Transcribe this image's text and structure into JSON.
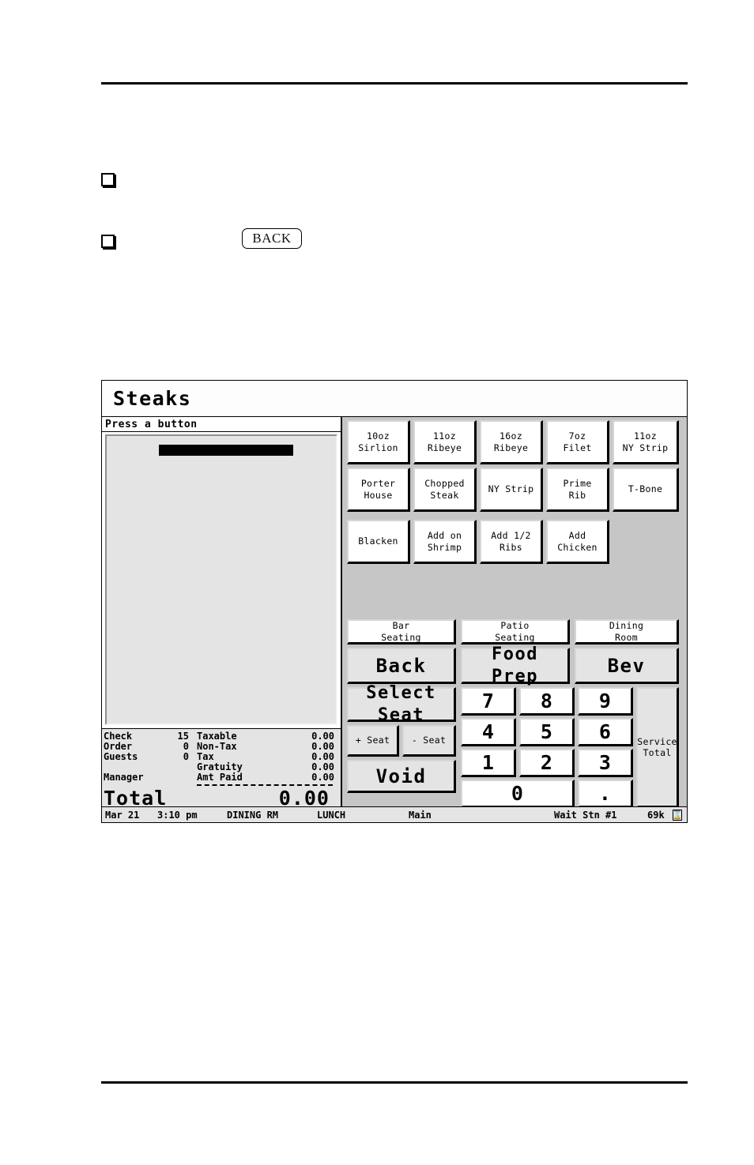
{
  "document": {
    "back_chip_label": "BACK",
    "bullets": [
      {
        "marker": "checkbox-square",
        "text": ""
      },
      {
        "marker": "checkbox-square",
        "text": ""
      }
    ]
  },
  "pos": {
    "title": "Steaks",
    "prompt": "Press a button",
    "order_display": {
      "redacted": true,
      "lines": []
    },
    "check": {
      "rows": [
        {
          "label": "Check",
          "qty": "15",
          "name": "Taxable",
          "amount": "0.00"
        },
        {
          "label": "Order",
          "qty": "0",
          "name": "Non-Tax",
          "amount": "0.00"
        },
        {
          "label": "Guests",
          "qty": "0",
          "name": "Tax",
          "amount": "0.00"
        },
        {
          "label": "",
          "qty": "",
          "name": "Gratuity",
          "amount": "0.00"
        },
        {
          "label": "Manager",
          "qty": "",
          "name": "Amt Paid",
          "amount": "0.00"
        }
      ],
      "total_label": "Total",
      "total_amount": "0.00"
    },
    "menu_buttons_row1": [
      "10oz\nSirlion",
      "11oz\nRibeye",
      "16oz\nRibeye",
      "7oz\nFilet",
      "11oz\nNY Strip"
    ],
    "menu_buttons_row2": [
      "Porter\nHouse",
      "Chopped\nSteak",
      "NY Strip",
      "Prime\nRib",
      "T-Bone"
    ],
    "menu_buttons_row3": [
      "Blacken",
      "Add on\nShrimp",
      "Add 1/2\nRibs",
      "Add\nChicken"
    ],
    "seating_buttons": [
      "Bar\nSeating",
      "Patio\nSeating",
      "Dining\nRoom"
    ],
    "function_buttons": [
      "Back",
      "Food\nPrep",
      "Bev"
    ],
    "select_seat_label": "Select\nSeat",
    "seat_plus_label": "+ Seat",
    "seat_minus_label": "- Seat",
    "void_label": "Void",
    "service_total_label": "Service\nTotal",
    "keypad": [
      "7",
      "8",
      "9",
      "4",
      "5",
      "6",
      "1",
      "2",
      "3"
    ],
    "keypad_zero": "0",
    "keypad_dot": ".",
    "status_bar": {
      "date": "Mar 21",
      "time": "3:10 pm",
      "room": "DINING RM",
      "meal": "LUNCH",
      "menu": "Main",
      "station": "Wait Stn #1",
      "memory": "69k",
      "icon": "hourglass-icon"
    }
  },
  "colors": {
    "panel_gray": "#c6c6c6",
    "button_face": "#ffffff",
    "button_gray": "#e4e4e4",
    "shadow": "#000000"
  }
}
